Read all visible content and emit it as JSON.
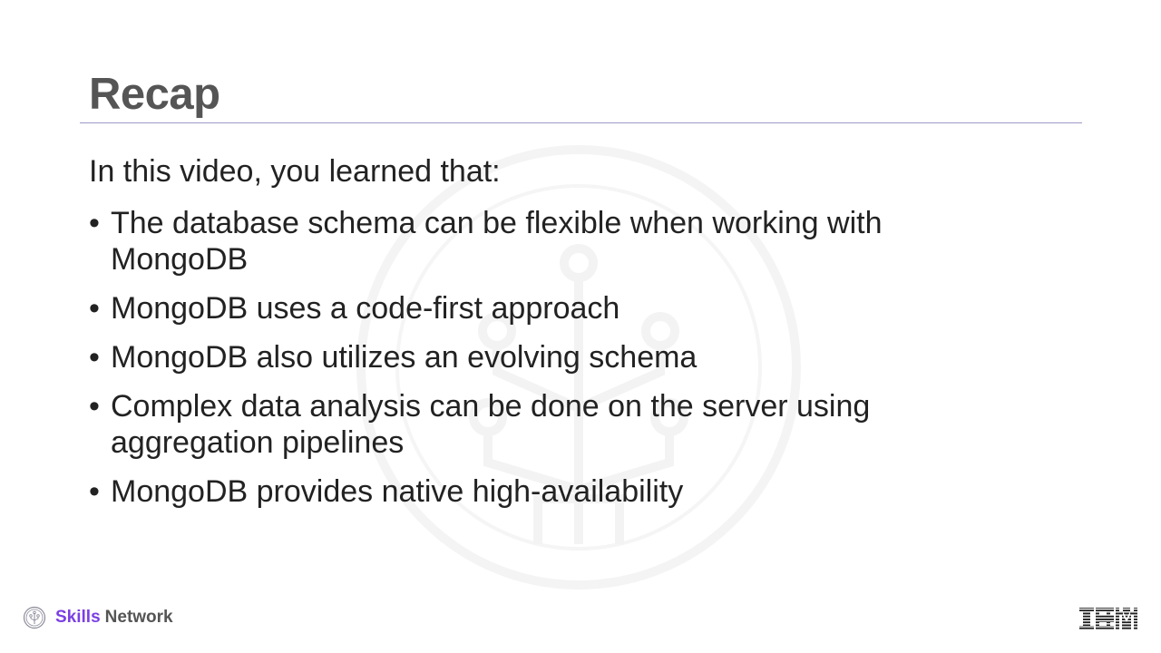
{
  "slide": {
    "title": "Recap",
    "intro": "In this video, you learned that:",
    "bullets": [
      "The database schema can be flexible when working with MongoDB",
      "MongoDB uses a code-first approach",
      "MongoDB also utilizes an evolving schema",
      "Complex data analysis can be done on the server using aggregation pipelines",
      "MongoDB provides native high-availability"
    ],
    "bullet_marker": "•"
  },
  "footer": {
    "brand_highlight": "Skills",
    "brand_rest": "Network",
    "brand_icon": "skills-network-logo-icon",
    "company_logo": "IBM",
    "brand_color": "#7b3fe4"
  },
  "colors": {
    "title": "#555555",
    "body_text": "#222222",
    "rule": "#9c9ac8",
    "watermark": "#f4f4f4"
  }
}
